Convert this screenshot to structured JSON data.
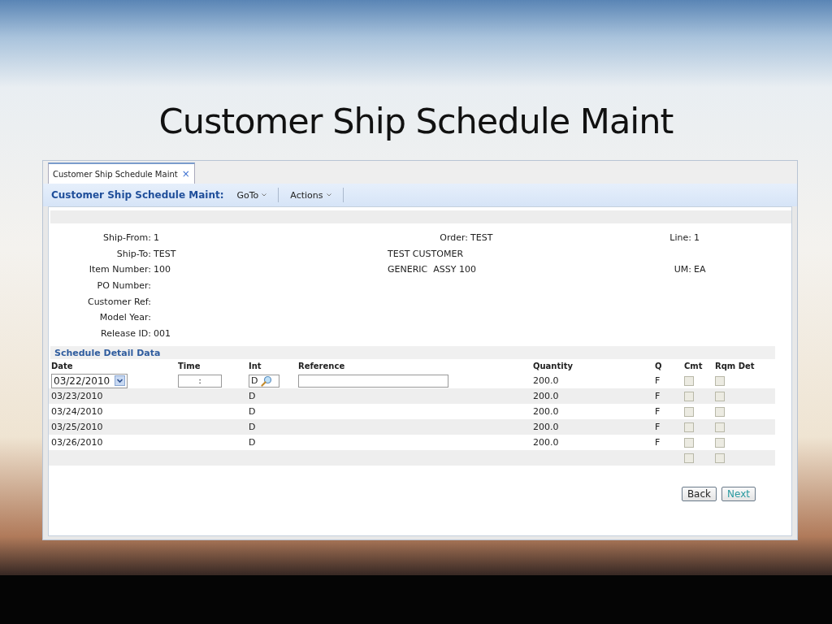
{
  "slide": {
    "title": "Customer Ship Schedule Maint"
  },
  "tabs": [
    {
      "label": "Customer Ship Schedule Maint",
      "close": "×",
      "selected": true
    }
  ],
  "toolbar": {
    "title": "Customer Ship Schedule Maint:",
    "menus": [
      {
        "label": "GoTo"
      },
      {
        "label": "Actions"
      }
    ]
  },
  "header_rows": [
    {
      "left": {
        "label": "Ship-From:",
        "value": "1"
      },
      "center": {
        "label": "Order:",
        "value": "TEST"
      },
      "right": {
        "label": "Line:",
        "value": "1"
      }
    },
    {
      "left": {
        "label": "Ship-To:",
        "value": "TEST"
      },
      "center": {
        "text": "TEST CUSTOMER"
      }
    },
    {
      "left": {
        "label": "Item Number:",
        "value": "100"
      },
      "center": {
        "text": "GENERIC  ASSY 100"
      },
      "right": {
        "label": "UM:",
        "value": "EA"
      }
    },
    {
      "left": {
        "label": "PO Number:"
      }
    },
    {
      "left": {
        "label": "Customer Ref:"
      }
    },
    {
      "left": {
        "label": "Model Year:"
      }
    },
    {
      "left": {
        "label": "Release ID:",
        "value": "001"
      }
    }
  ],
  "section_title": "Schedule Detail Data",
  "table": {
    "columns": [
      "Date",
      "Time",
      "Int",
      "Reference",
      "Quantity",
      "Q",
      "Cmt",
      "Rqm Det"
    ],
    "rows": [
      {
        "kind": "edit",
        "date": "03/22/2010",
        "time": ":",
        "int": "D",
        "quantity": "200.0",
        "q": "F",
        "cmt": false,
        "rqm_det": false
      },
      {
        "kind": "display",
        "date": "03/23/2010",
        "int": "D",
        "quantity": "200.0",
        "q": "F",
        "cmt": false,
        "rqm_det": false
      },
      {
        "kind": "display",
        "date": "03/24/2010",
        "int": "D",
        "quantity": "200.0",
        "q": "F",
        "cmt": false,
        "rqm_det": false
      },
      {
        "kind": "display",
        "date": "03/25/2010",
        "int": "D",
        "quantity": "200.0",
        "q": "F",
        "cmt": false,
        "rqm_det": false
      },
      {
        "kind": "display",
        "date": "03/26/2010",
        "int": "D",
        "quantity": "200.0",
        "q": "F",
        "cmt": false,
        "rqm_det": false
      },
      {
        "kind": "blank",
        "cmt": false,
        "rqm_det": false
      }
    ]
  },
  "buttons": [
    {
      "label": "Back",
      "kind": "normal"
    },
    {
      "label": "Next",
      "kind": "accent"
    }
  ]
}
